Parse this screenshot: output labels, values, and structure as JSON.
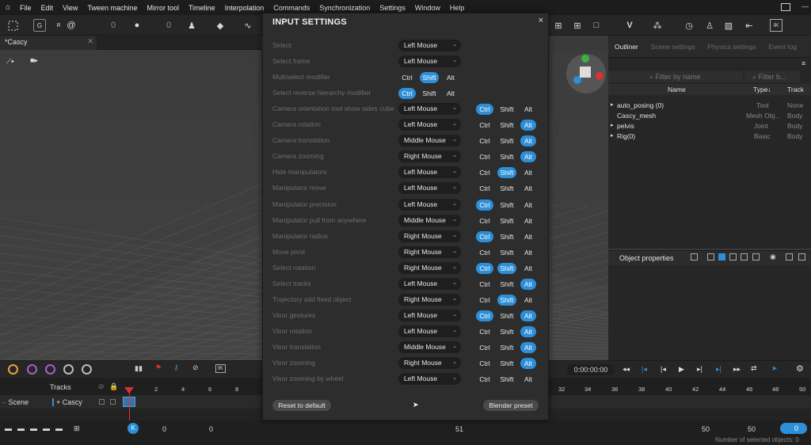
{
  "menu": [
    "File",
    "Edit",
    "View",
    "Tween machine",
    "Mirror tool",
    "Timeline",
    "Interpolation",
    "Commands",
    "Synchronization",
    "Settings",
    "Window",
    "Help"
  ],
  "toolbar": {
    "g_label": "G",
    "r_label": "R",
    "num1": "0",
    "num2": "0",
    "ik_label": "IK"
  },
  "doc_tab": {
    "label": "*Cascy"
  },
  "right_tabs": [
    "Outliner",
    "Scene settings",
    "Physics settings",
    "Event log"
  ],
  "outliner": {
    "filter_placeholder": "Filter by name",
    "filter2_placeholder": "Filter b...",
    "columns": [
      "Name",
      "Type↓",
      "Track"
    ],
    "rows": [
      {
        "name": "auto_posing (0)",
        "type": "Tool",
        "track": "None",
        "arrow": true
      },
      {
        "name": "Cascy_mesh",
        "type": "Mesh Obj...",
        "track": "Body",
        "arrow": false
      },
      {
        "name": "pelvis",
        "type": "Joint",
        "track": "Body",
        "arrow": true
      },
      {
        "name": "Rig(0)",
        "type": "Basic",
        "track": "Body",
        "arrow": true
      }
    ]
  },
  "object_properties": {
    "title": "Object properties"
  },
  "dialog": {
    "title": "INPUT SETTINGS",
    "close": "×",
    "reset_label": "Reset to default",
    "preset_label": "Blender preset",
    "rows": [
      {
        "label": "Select",
        "mouse": "Left Mouse",
        "mods": null
      },
      {
        "label": "Select frame",
        "mouse": "Left Mouse",
        "mods": null
      },
      {
        "label": "Multiselect modifier",
        "mouse": null,
        "mods": [
          "Ctrl",
          "Shift",
          "Alt"
        ],
        "active": [
          false,
          true,
          false
        ],
        "inline": true
      },
      {
        "label": "Select reverse hierarchy modifier",
        "mouse": null,
        "mods": [
          "Ctrl",
          "Shift",
          "Alt"
        ],
        "active": [
          true,
          false,
          false
        ],
        "inline": true
      },
      {
        "label": "Camera orientation tool show sides cube",
        "mouse": "Left Mouse",
        "mods": [
          "Ctrl",
          "Shift",
          "Alt"
        ],
        "active": [
          true,
          false,
          false
        ]
      },
      {
        "label": "Camera rotation",
        "mouse": "Left Mouse",
        "mods": [
          "Ctrl",
          "Shift",
          "Alt"
        ],
        "active": [
          false,
          false,
          true
        ]
      },
      {
        "label": "Camera translation",
        "mouse": "Middle Mouse",
        "mods": [
          "Ctrl",
          "Shift",
          "Alt"
        ],
        "active": [
          false,
          false,
          true
        ]
      },
      {
        "label": "Camera zooming",
        "mouse": "Right Mouse",
        "mods": [
          "Ctrl",
          "Shift",
          "Alt"
        ],
        "active": [
          false,
          false,
          true
        ]
      },
      {
        "label": "Hide manipulators",
        "mouse": "Left Mouse",
        "mods": [
          "Ctrl",
          "Shift",
          "Alt"
        ],
        "active": [
          false,
          true,
          false
        ]
      },
      {
        "label": "Manipulator move",
        "mouse": "Left Mouse",
        "mods": [
          "Ctrl",
          "Shift",
          "Alt"
        ],
        "active": [
          false,
          false,
          false
        ]
      },
      {
        "label": "Manipulator precision",
        "mouse": "Left Mouse",
        "mods": [
          "Ctrl",
          "Shift",
          "Alt"
        ],
        "active": [
          true,
          false,
          false
        ]
      },
      {
        "label": "Manipulator pull from anywhere",
        "mouse": "Middle Mouse",
        "mods": [
          "Ctrl",
          "Shift",
          "Alt"
        ],
        "active": [
          false,
          false,
          false
        ]
      },
      {
        "label": "Manipulator radius",
        "mouse": "Right Mouse",
        "mods": [
          "Ctrl",
          "Shift",
          "Alt"
        ],
        "active": [
          true,
          false,
          false
        ]
      },
      {
        "label": "Move pivot",
        "mouse": "Right Mouse",
        "mods": [
          "Ctrl",
          "Shift",
          "Alt"
        ],
        "active": [
          false,
          false,
          false
        ]
      },
      {
        "label": "Select rotation",
        "mouse": "Right Mouse",
        "mods": [
          "Ctrl",
          "Shift",
          "Alt"
        ],
        "active": [
          true,
          true,
          false
        ]
      },
      {
        "label": "Select tracks",
        "mouse": "Left Mouse",
        "mods": [
          "Ctrl",
          "Shift",
          "Alt"
        ],
        "active": [
          false,
          false,
          true
        ]
      },
      {
        "label": "Trajectory add fixed object",
        "mouse": "Right Mouse",
        "mods": [
          "Ctrl",
          "Shift",
          "Alt"
        ],
        "active": [
          false,
          true,
          false
        ]
      },
      {
        "label": "Visor gestures",
        "mouse": "Left Mouse",
        "mods": [
          "Ctrl",
          "Shift",
          "Alt"
        ],
        "active": [
          true,
          false,
          true
        ]
      },
      {
        "label": "Visor rotation",
        "mouse": "Left Mouse",
        "mods": [
          "Ctrl",
          "Shift",
          "Alt"
        ],
        "active": [
          false,
          false,
          true
        ]
      },
      {
        "label": "Visor translation",
        "mouse": "Middle Mouse",
        "mods": [
          "Ctrl",
          "Shift",
          "Alt"
        ],
        "active": [
          false,
          false,
          true
        ]
      },
      {
        "label": "Visor zooming",
        "mouse": "Right Mouse",
        "mods": [
          "Ctrl",
          "Shift",
          "Alt"
        ],
        "active": [
          false,
          false,
          true
        ]
      },
      {
        "label": "Visor zooming by wheel",
        "mouse": "Left Mouse",
        "mods": [
          "Ctrl",
          "Shift",
          "Alt"
        ],
        "active": [
          false,
          false,
          false
        ]
      }
    ]
  },
  "timeline": {
    "tracks_label": "Tracks",
    "scene_label": "Scene",
    "object_label": "Cascy",
    "time": "0:00:00:00",
    "ticks": [
      "0",
      "2",
      "4",
      "6",
      "8",
      "32",
      "34",
      "36",
      "38",
      "40",
      "42",
      "44",
      "46",
      "48",
      "50"
    ],
    "ik_label": "IK"
  },
  "status": {
    "start": "0",
    "current": "0",
    "mid": "51",
    "end": "50",
    "end2": "50",
    "right_val": "0",
    "selected": "Number of selected objects: 0"
  },
  "colors": {
    "accent": "#2d8fd8",
    "playhead": "#d83232"
  }
}
